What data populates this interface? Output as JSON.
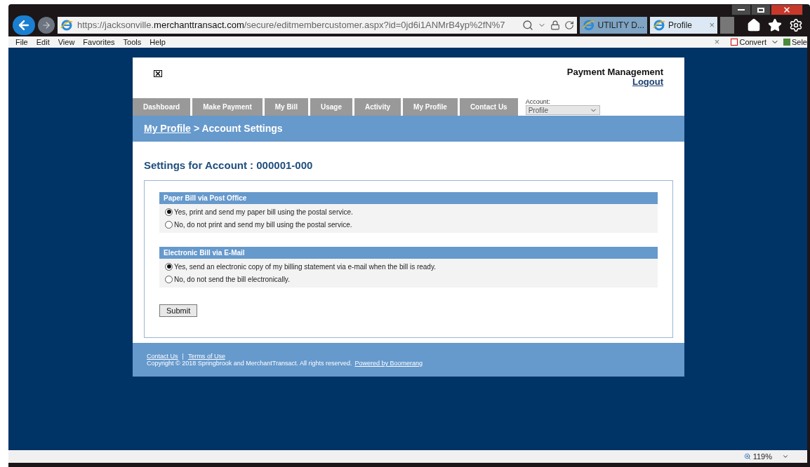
{
  "browser": {
    "url": {
      "start": "https://jacksonville.",
      "domain": "merchanttransact.com",
      "rest": "/secure/editmembercustomer.aspx?id=0jd6i1ANMrB4yp%2fN%7"
    },
    "tabs": [
      {
        "label": "UTILITY D...",
        "selected": false
      },
      {
        "label": "Profile",
        "selected": true,
        "close": "×"
      }
    ],
    "menu": [
      "File",
      "Edit",
      "View",
      "Favorites",
      "Tools",
      "Help"
    ],
    "toolbar": {
      "close": "×",
      "convert": "Convert",
      "select": "Sele"
    },
    "zoom": "119%"
  },
  "page": {
    "title": "Payment Management",
    "logout": "Logout",
    "nav": [
      {
        "label": "Dashboard"
      },
      {
        "label": "Make Payment"
      },
      {
        "label": "My Bill"
      },
      {
        "label": "Usage"
      },
      {
        "label": "Activity"
      },
      {
        "label": "My Profile"
      },
      {
        "label": "Contact Us"
      }
    ],
    "account": {
      "label": "Account:",
      "value": "Profile"
    },
    "breadcrumb": {
      "link": "My Profile",
      "rest": "> Account Settings"
    },
    "heading": "Settings for Account : 000001-000",
    "sections": [
      {
        "title": "Paper Bill via Post Office",
        "options": [
          {
            "label": "Yes, print and send my paper bill using the postal service.",
            "selected": true
          },
          {
            "label": "No, do not print and send my bill using the postal service.",
            "selected": false
          }
        ]
      },
      {
        "title": "Electronic Bill via E-Mail",
        "options": [
          {
            "label": "Yes, send an electronic copy of my billing statement via e-mail when the bill is ready.",
            "selected": true
          },
          {
            "label": "No, do not send the bill electronically.",
            "selected": false
          }
        ]
      }
    ],
    "submit": "Submit",
    "footer": {
      "links": [
        "Contact Us",
        "Terms of Use"
      ],
      "separator": "|",
      "copyright": "Copyright © 2018 Springbrook and MerchantTransact. All rights reserved.",
      "powered": "Powered by Boomerang"
    }
  }
}
